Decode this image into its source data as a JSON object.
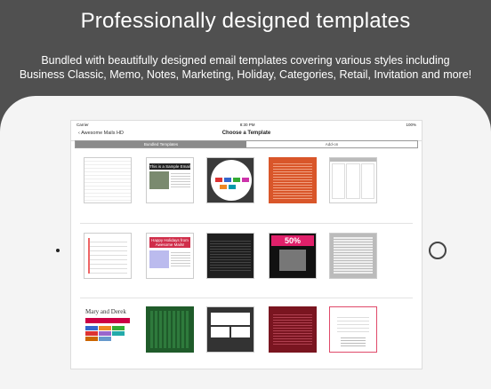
{
  "headline": "Professionally designed templates",
  "subline1": "Bundled with beautifully designed email templates covering various styles including",
  "subline2": "Business Classic, Memo, Notes, Marketing, Holiday, Categories, Retail, Invitation and more!",
  "status": {
    "carrier": "Carrier",
    "time": "8:30 PM",
    "battery": "100%"
  },
  "nav": {
    "back": "Awesome Mails HD",
    "title": "Choose a Template"
  },
  "tabs": {
    "bundled": "Bundled Templates",
    "addon": "Add-on"
  },
  "thumbs": {
    "sample_email": "This is a Sample Email",
    "holiday": "Happy Holidays from Awesome Mails!",
    "sale": "50%",
    "wedding": "Mary and Derek"
  },
  "colors": {
    "background": "#505050",
    "accent": "#e04a2a"
  }
}
